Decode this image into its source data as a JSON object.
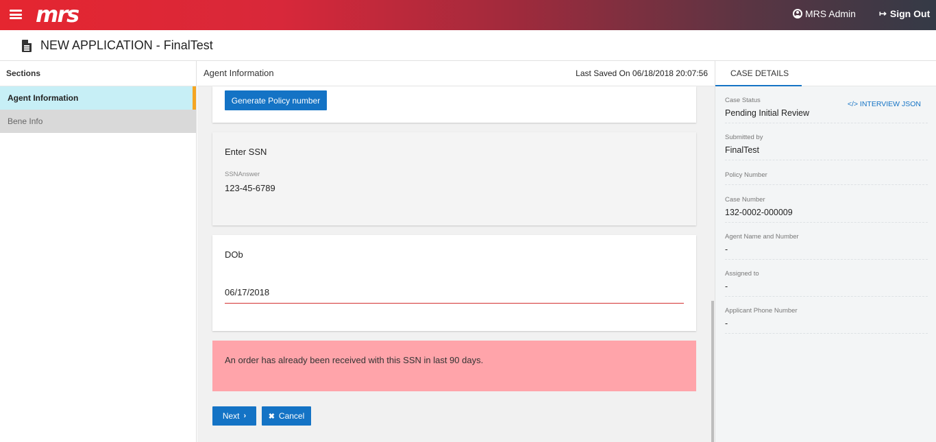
{
  "header": {
    "logo": "mrs",
    "user_label": "MRS Admin",
    "signout_label": "Sign Out",
    "brand_gradient": [
      "#e52630",
      "#343a46"
    ]
  },
  "page": {
    "title": "NEW APPLICATION - FinalTest"
  },
  "sections": {
    "heading": "Sections",
    "items": [
      {
        "label": "Agent Information",
        "active": true
      },
      {
        "label": "Bene Info",
        "active": false
      }
    ]
  },
  "main": {
    "heading": "Agent Information",
    "last_saved": "Last Saved On 06/18/2018 20:07:56",
    "generate_button": "Generate Policy number",
    "ssn": {
      "question": "Enter SSN",
      "field_label": "SSNAnswer",
      "value": "123-45-6789"
    },
    "dob": {
      "question": "DOb",
      "value": "06/17/2018"
    },
    "alert": "An order has already been received with this SSN in last 90 days.",
    "next_button": "Next",
    "cancel_button": "Cancel"
  },
  "case_details": {
    "tab": "CASE DETAILS",
    "interview_link": "INTERVIEW JSON",
    "fields": [
      {
        "label": "Case Status",
        "value": "Pending Initial Review"
      },
      {
        "label": "Submitted by",
        "value": "FinalTest"
      },
      {
        "label": "Policy Number",
        "value": ""
      },
      {
        "label": "Case Number",
        "value": "132-0002-000009"
      },
      {
        "label": "Agent Name and Number",
        "value": "-"
      },
      {
        "label": "Assigned to",
        "value": "-"
      },
      {
        "label": "Applicant Phone Number",
        "value": "-"
      }
    ]
  },
  "colors": {
    "primary_button": "#1473c5",
    "active_section": "#c7eff6",
    "active_marker": "#f5a623",
    "alert_bg": "#ffa4aa",
    "error_underline": "#d32f2f"
  }
}
